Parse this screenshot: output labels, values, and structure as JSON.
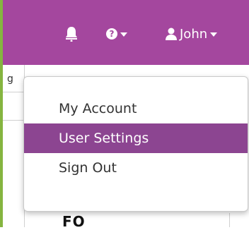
{
  "navbar": {
    "bell_icon": "bell-icon",
    "help_icon": "question-circle-icon",
    "help_symbol": "?",
    "user_icon": "user-icon",
    "user_name": "John"
  },
  "background": {
    "left_cell_text": "g",
    "partial_text": "FO"
  },
  "user_menu": {
    "items": [
      {
        "label": "My Account",
        "active": false
      },
      {
        "label": "User Settings",
        "active": true
      },
      {
        "label": "Sign Out",
        "active": false
      }
    ]
  },
  "colors": {
    "navbar_bg": "#a4479e",
    "active_item_bg": "#8c4591",
    "left_border": "#85b540"
  }
}
